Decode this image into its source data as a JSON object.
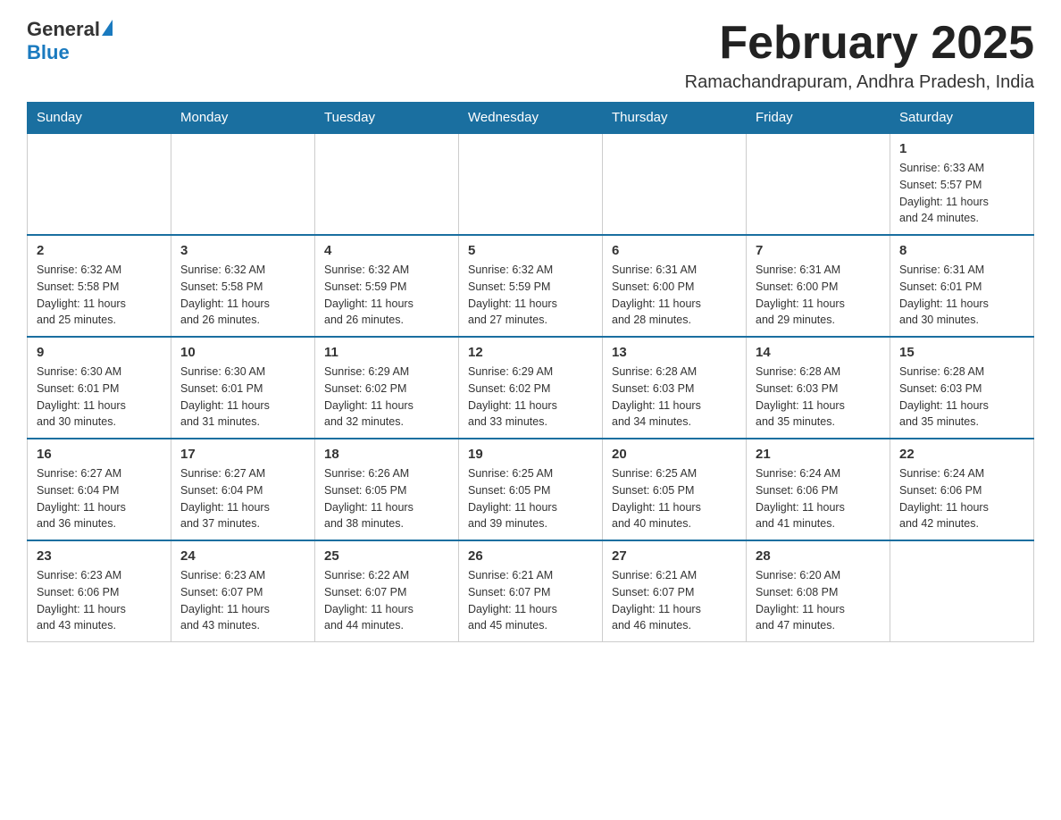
{
  "header": {
    "logo_general": "General",
    "logo_blue": "Blue",
    "month_title": "February 2025",
    "location": "Ramachandrapuram, Andhra Pradesh, India"
  },
  "weekdays": [
    "Sunday",
    "Monday",
    "Tuesday",
    "Wednesday",
    "Thursday",
    "Friday",
    "Saturday"
  ],
  "weeks": [
    [
      {
        "day": "",
        "info": ""
      },
      {
        "day": "",
        "info": ""
      },
      {
        "day": "",
        "info": ""
      },
      {
        "day": "",
        "info": ""
      },
      {
        "day": "",
        "info": ""
      },
      {
        "day": "",
        "info": ""
      },
      {
        "day": "1",
        "info": "Sunrise: 6:33 AM\nSunset: 5:57 PM\nDaylight: 11 hours\nand 24 minutes."
      }
    ],
    [
      {
        "day": "2",
        "info": "Sunrise: 6:32 AM\nSunset: 5:58 PM\nDaylight: 11 hours\nand 25 minutes."
      },
      {
        "day": "3",
        "info": "Sunrise: 6:32 AM\nSunset: 5:58 PM\nDaylight: 11 hours\nand 26 minutes."
      },
      {
        "day": "4",
        "info": "Sunrise: 6:32 AM\nSunset: 5:59 PM\nDaylight: 11 hours\nand 26 minutes."
      },
      {
        "day": "5",
        "info": "Sunrise: 6:32 AM\nSunset: 5:59 PM\nDaylight: 11 hours\nand 27 minutes."
      },
      {
        "day": "6",
        "info": "Sunrise: 6:31 AM\nSunset: 6:00 PM\nDaylight: 11 hours\nand 28 minutes."
      },
      {
        "day": "7",
        "info": "Sunrise: 6:31 AM\nSunset: 6:00 PM\nDaylight: 11 hours\nand 29 minutes."
      },
      {
        "day": "8",
        "info": "Sunrise: 6:31 AM\nSunset: 6:01 PM\nDaylight: 11 hours\nand 30 minutes."
      }
    ],
    [
      {
        "day": "9",
        "info": "Sunrise: 6:30 AM\nSunset: 6:01 PM\nDaylight: 11 hours\nand 30 minutes."
      },
      {
        "day": "10",
        "info": "Sunrise: 6:30 AM\nSunset: 6:01 PM\nDaylight: 11 hours\nand 31 minutes."
      },
      {
        "day": "11",
        "info": "Sunrise: 6:29 AM\nSunset: 6:02 PM\nDaylight: 11 hours\nand 32 minutes."
      },
      {
        "day": "12",
        "info": "Sunrise: 6:29 AM\nSunset: 6:02 PM\nDaylight: 11 hours\nand 33 minutes."
      },
      {
        "day": "13",
        "info": "Sunrise: 6:28 AM\nSunset: 6:03 PM\nDaylight: 11 hours\nand 34 minutes."
      },
      {
        "day": "14",
        "info": "Sunrise: 6:28 AM\nSunset: 6:03 PM\nDaylight: 11 hours\nand 35 minutes."
      },
      {
        "day": "15",
        "info": "Sunrise: 6:28 AM\nSunset: 6:03 PM\nDaylight: 11 hours\nand 35 minutes."
      }
    ],
    [
      {
        "day": "16",
        "info": "Sunrise: 6:27 AM\nSunset: 6:04 PM\nDaylight: 11 hours\nand 36 minutes."
      },
      {
        "day": "17",
        "info": "Sunrise: 6:27 AM\nSunset: 6:04 PM\nDaylight: 11 hours\nand 37 minutes."
      },
      {
        "day": "18",
        "info": "Sunrise: 6:26 AM\nSunset: 6:05 PM\nDaylight: 11 hours\nand 38 minutes."
      },
      {
        "day": "19",
        "info": "Sunrise: 6:25 AM\nSunset: 6:05 PM\nDaylight: 11 hours\nand 39 minutes."
      },
      {
        "day": "20",
        "info": "Sunrise: 6:25 AM\nSunset: 6:05 PM\nDaylight: 11 hours\nand 40 minutes."
      },
      {
        "day": "21",
        "info": "Sunrise: 6:24 AM\nSunset: 6:06 PM\nDaylight: 11 hours\nand 41 minutes."
      },
      {
        "day": "22",
        "info": "Sunrise: 6:24 AM\nSunset: 6:06 PM\nDaylight: 11 hours\nand 42 minutes."
      }
    ],
    [
      {
        "day": "23",
        "info": "Sunrise: 6:23 AM\nSunset: 6:06 PM\nDaylight: 11 hours\nand 43 minutes."
      },
      {
        "day": "24",
        "info": "Sunrise: 6:23 AM\nSunset: 6:07 PM\nDaylight: 11 hours\nand 43 minutes."
      },
      {
        "day": "25",
        "info": "Sunrise: 6:22 AM\nSunset: 6:07 PM\nDaylight: 11 hours\nand 44 minutes."
      },
      {
        "day": "26",
        "info": "Sunrise: 6:21 AM\nSunset: 6:07 PM\nDaylight: 11 hours\nand 45 minutes."
      },
      {
        "day": "27",
        "info": "Sunrise: 6:21 AM\nSunset: 6:07 PM\nDaylight: 11 hours\nand 46 minutes."
      },
      {
        "day": "28",
        "info": "Sunrise: 6:20 AM\nSunset: 6:08 PM\nDaylight: 11 hours\nand 47 minutes."
      },
      {
        "day": "",
        "info": ""
      }
    ]
  ]
}
